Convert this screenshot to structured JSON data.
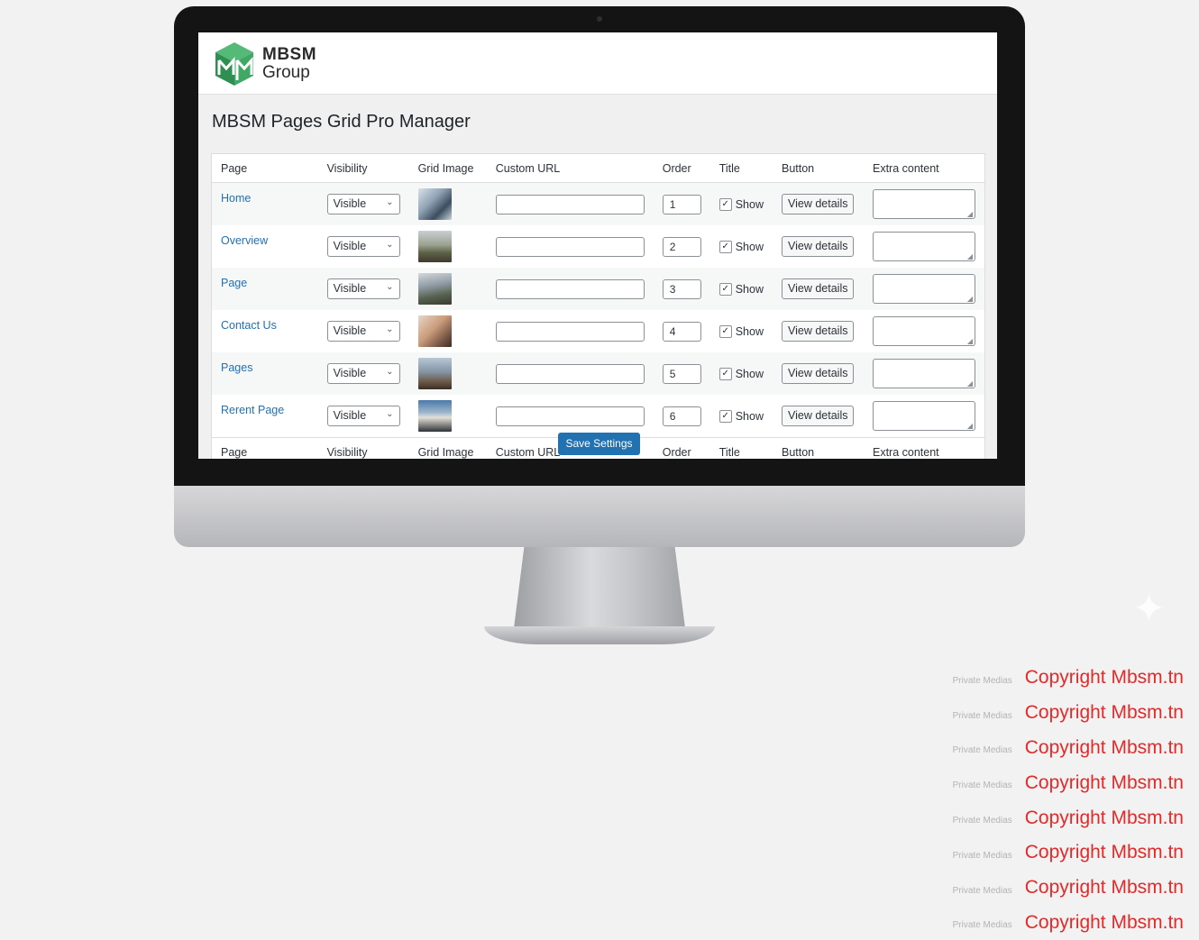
{
  "app": {
    "logo_name": "MBSM",
    "logo_group": "Group",
    "title": "MBSM Pages Grid Pro Manager"
  },
  "table": {
    "headers": [
      "Page",
      "Visibility",
      "Grid Image",
      "Custom URL",
      "Order",
      "Title",
      "Button",
      "Extra content"
    ],
    "rows": [
      {
        "page": "Home",
        "visibility": "Visible",
        "image": "home-thumbnail",
        "custom_url": "",
        "order": "1",
        "title_checked": true,
        "title_label": "Show",
        "button": "View details",
        "extra": ""
      },
      {
        "page": "Overview",
        "visibility": "Visible",
        "image": "overview-thumbnail",
        "custom_url": "",
        "order": "2",
        "title_checked": true,
        "title_label": "Show",
        "button": "View details",
        "extra": ""
      },
      {
        "page": "Page",
        "visibility": "Visible",
        "image": "page-thumbnail",
        "custom_url": "",
        "order": "3",
        "title_checked": true,
        "title_label": "Show",
        "button": "View details",
        "extra": ""
      },
      {
        "page": "Contact Us",
        "visibility": "Visible",
        "image": "contact-thumbnail",
        "custom_url": "",
        "order": "4",
        "title_checked": true,
        "title_label": "Show",
        "button": "View details",
        "extra": ""
      },
      {
        "page": "Pages",
        "visibility": "Visible",
        "image": "pages-thumbnail",
        "custom_url": "",
        "order": "5",
        "title_checked": true,
        "title_label": "Show",
        "button": "View details",
        "extra": ""
      },
      {
        "page": "Rerent Page",
        "visibility": "Visible",
        "image": "rerent-thumbnail",
        "custom_url": "",
        "order": "6",
        "title_checked": true,
        "title_label": "Show",
        "button": "View details",
        "extra": ""
      }
    ]
  },
  "save_button": "Save Settings",
  "watermark": {
    "small": "Private Medias",
    "big": "Copyright Mbsm.tn",
    "count": 8
  },
  "colors": {
    "link": "#2271b1",
    "primary_button": "#2271b1",
    "watermark_red": "#e22a2a",
    "logo_green": "#2f9e5a"
  },
  "icons": [
    "chevron-down-icon",
    "checkmark-icon",
    "resize-grip-icon",
    "mbsm-logo-icon"
  ]
}
